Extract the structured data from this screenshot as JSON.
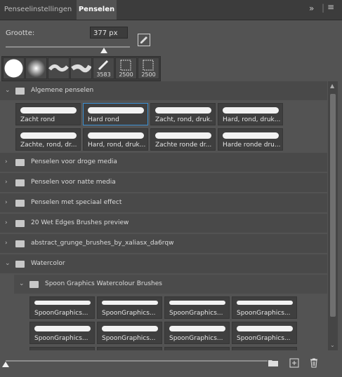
{
  "tabs": [
    {
      "label": "Penseelinstellingen",
      "active": false
    },
    {
      "label": "Penselen",
      "active": true
    }
  ],
  "size": {
    "label": "Grootte:",
    "value": "377 px"
  },
  "preset_counts": [
    "3583",
    "2500",
    "2500"
  ],
  "groups": [
    {
      "label": "Algemene penselen",
      "expanded": true
    },
    {
      "label": "Penselen voor droge media",
      "expanded": false
    },
    {
      "label": "Penselen voor natte media",
      "expanded": false
    },
    {
      "label": "Penselen met speciaal effect",
      "expanded": false
    },
    {
      "label": "20 Wet Edges  Brushes preview",
      "expanded": false
    },
    {
      "label": "abstract_grunge_brushes_by_xaliasx_da6rqw",
      "expanded": false
    },
    {
      "label": "Watercolor",
      "expanded": true
    }
  ],
  "subgroup": {
    "label": "Spoon Graphics Watercolour Brushes",
    "expanded": true
  },
  "general_brushes": [
    "Zacht rond",
    "Hard rond",
    "Zacht, rond, druk...",
    "Hard, rond, druk...",
    "Zachte, rond, dr...",
    "Hard, rond, druk...",
    "Zachte ronde dr...",
    "Harde ronde dru..."
  ],
  "spoon_brushes": [
    "SpoonGraphics...",
    "SpoonGraphics...",
    "SpoonGraphics...",
    "SpoonGraphics...",
    "SpoonGraphics...",
    "SpoonGraphics...",
    "SpoonGraphics...",
    "SpoonGraphics..."
  ],
  "icons": {
    "menu": "menu-icon",
    "collapse": "double-chevron-icon",
    "new_folder": "folder-icon",
    "new_brush": "new-brush-icon",
    "delete": "trash-icon"
  }
}
